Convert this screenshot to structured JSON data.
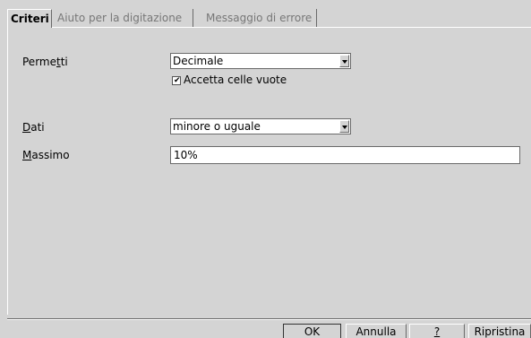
{
  "tabs": [
    {
      "label": "Criteri"
    },
    {
      "label": "Aiuto per la digitazione"
    },
    {
      "label": "Messaggio di errore"
    }
  ],
  "criteria": {
    "allow_label_prefix": "Perme",
    "allow_label_mnemonic": "t",
    "allow_label_suffix": "ti",
    "allow_value": "Decimale",
    "allow_empty_label": "Accetta celle vuote",
    "allow_empty_checked": true,
    "data_label_mnemonic": "D",
    "data_label_suffix": "ati",
    "data_value": "minore o uguale",
    "max_label_mnemonic": "M",
    "max_label_suffix": "assimo",
    "max_value": "10%"
  },
  "buttons": {
    "ok": "OK",
    "cancel": "Annulla",
    "help": "?",
    "reset": "Ripristina"
  },
  "icons": {
    "checkmark_glyph": "✔",
    "dropdown": "chevron-down-icon"
  }
}
